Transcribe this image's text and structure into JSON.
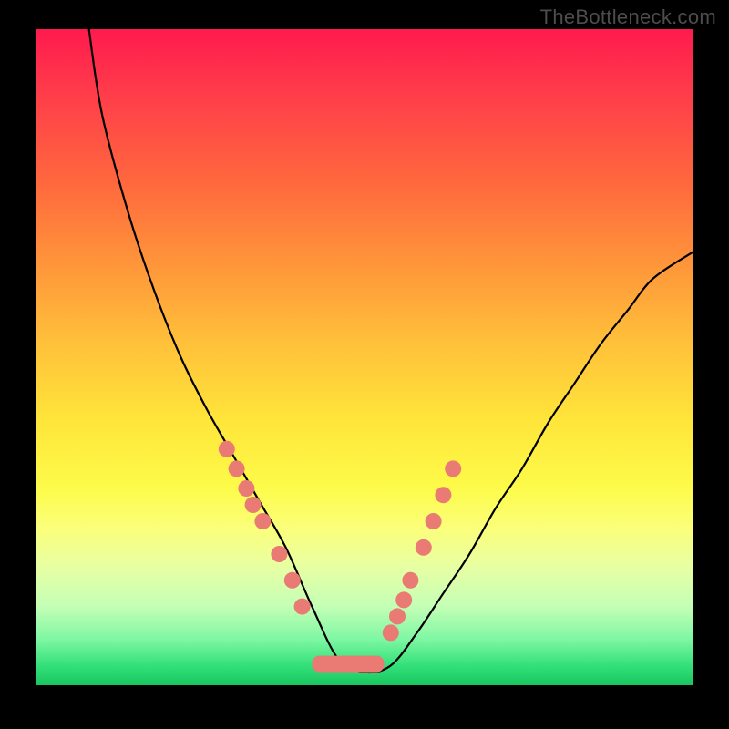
{
  "watermark": "TheBottleneck.com",
  "colors": {
    "background": "#000000",
    "watermark": "#4d4d4d",
    "curve": "#000000",
    "marker": "#e97a74",
    "gradient_top": "#ff1a4e",
    "gradient_bottom": "#19c65e"
  },
  "chart_data": {
    "type": "line",
    "title": "",
    "xlabel": "",
    "ylabel": "",
    "xlim": [
      0,
      100
    ],
    "ylim": [
      0,
      100
    ],
    "grid": false,
    "legend": false,
    "curve_notes": "V-shaped bottleneck curve; left branch steep rising to ~100 at x≈8, trough between x≈42–52 at y≈2, right branch rising to ~66 at x=100",
    "series": [
      {
        "name": "bottleneck-curve",
        "x": [
          8,
          10,
          14,
          18,
          22,
          26,
          30,
          34,
          38,
          42,
          46,
          50,
          54,
          58,
          62,
          66,
          70,
          74,
          78,
          82,
          86,
          90,
          94,
          100
        ],
        "y": [
          100,
          87,
          72,
          60,
          50,
          42,
          35,
          28,
          21,
          12,
          4,
          2,
          3,
          8,
          14,
          20,
          27,
          33,
          40,
          46,
          52,
          57,
          62,
          66
        ]
      },
      {
        "name": "marker-dots",
        "type": "scatter",
        "x": [
          29,
          30.5,
          32,
          33,
          34.5,
          37,
          39,
          40.5,
          54,
          55,
          56,
          57,
          59,
          60.5,
          62,
          63.5
        ],
        "y": [
          36,
          33,
          30,
          27.5,
          25,
          20,
          16,
          12,
          8,
          10.5,
          13,
          16,
          21,
          25,
          29,
          33
        ]
      }
    ],
    "trough_band": {
      "x_start": 42,
      "x_end": 53,
      "y": 2,
      "height": 2.5
    },
    "axes_visible": false
  }
}
